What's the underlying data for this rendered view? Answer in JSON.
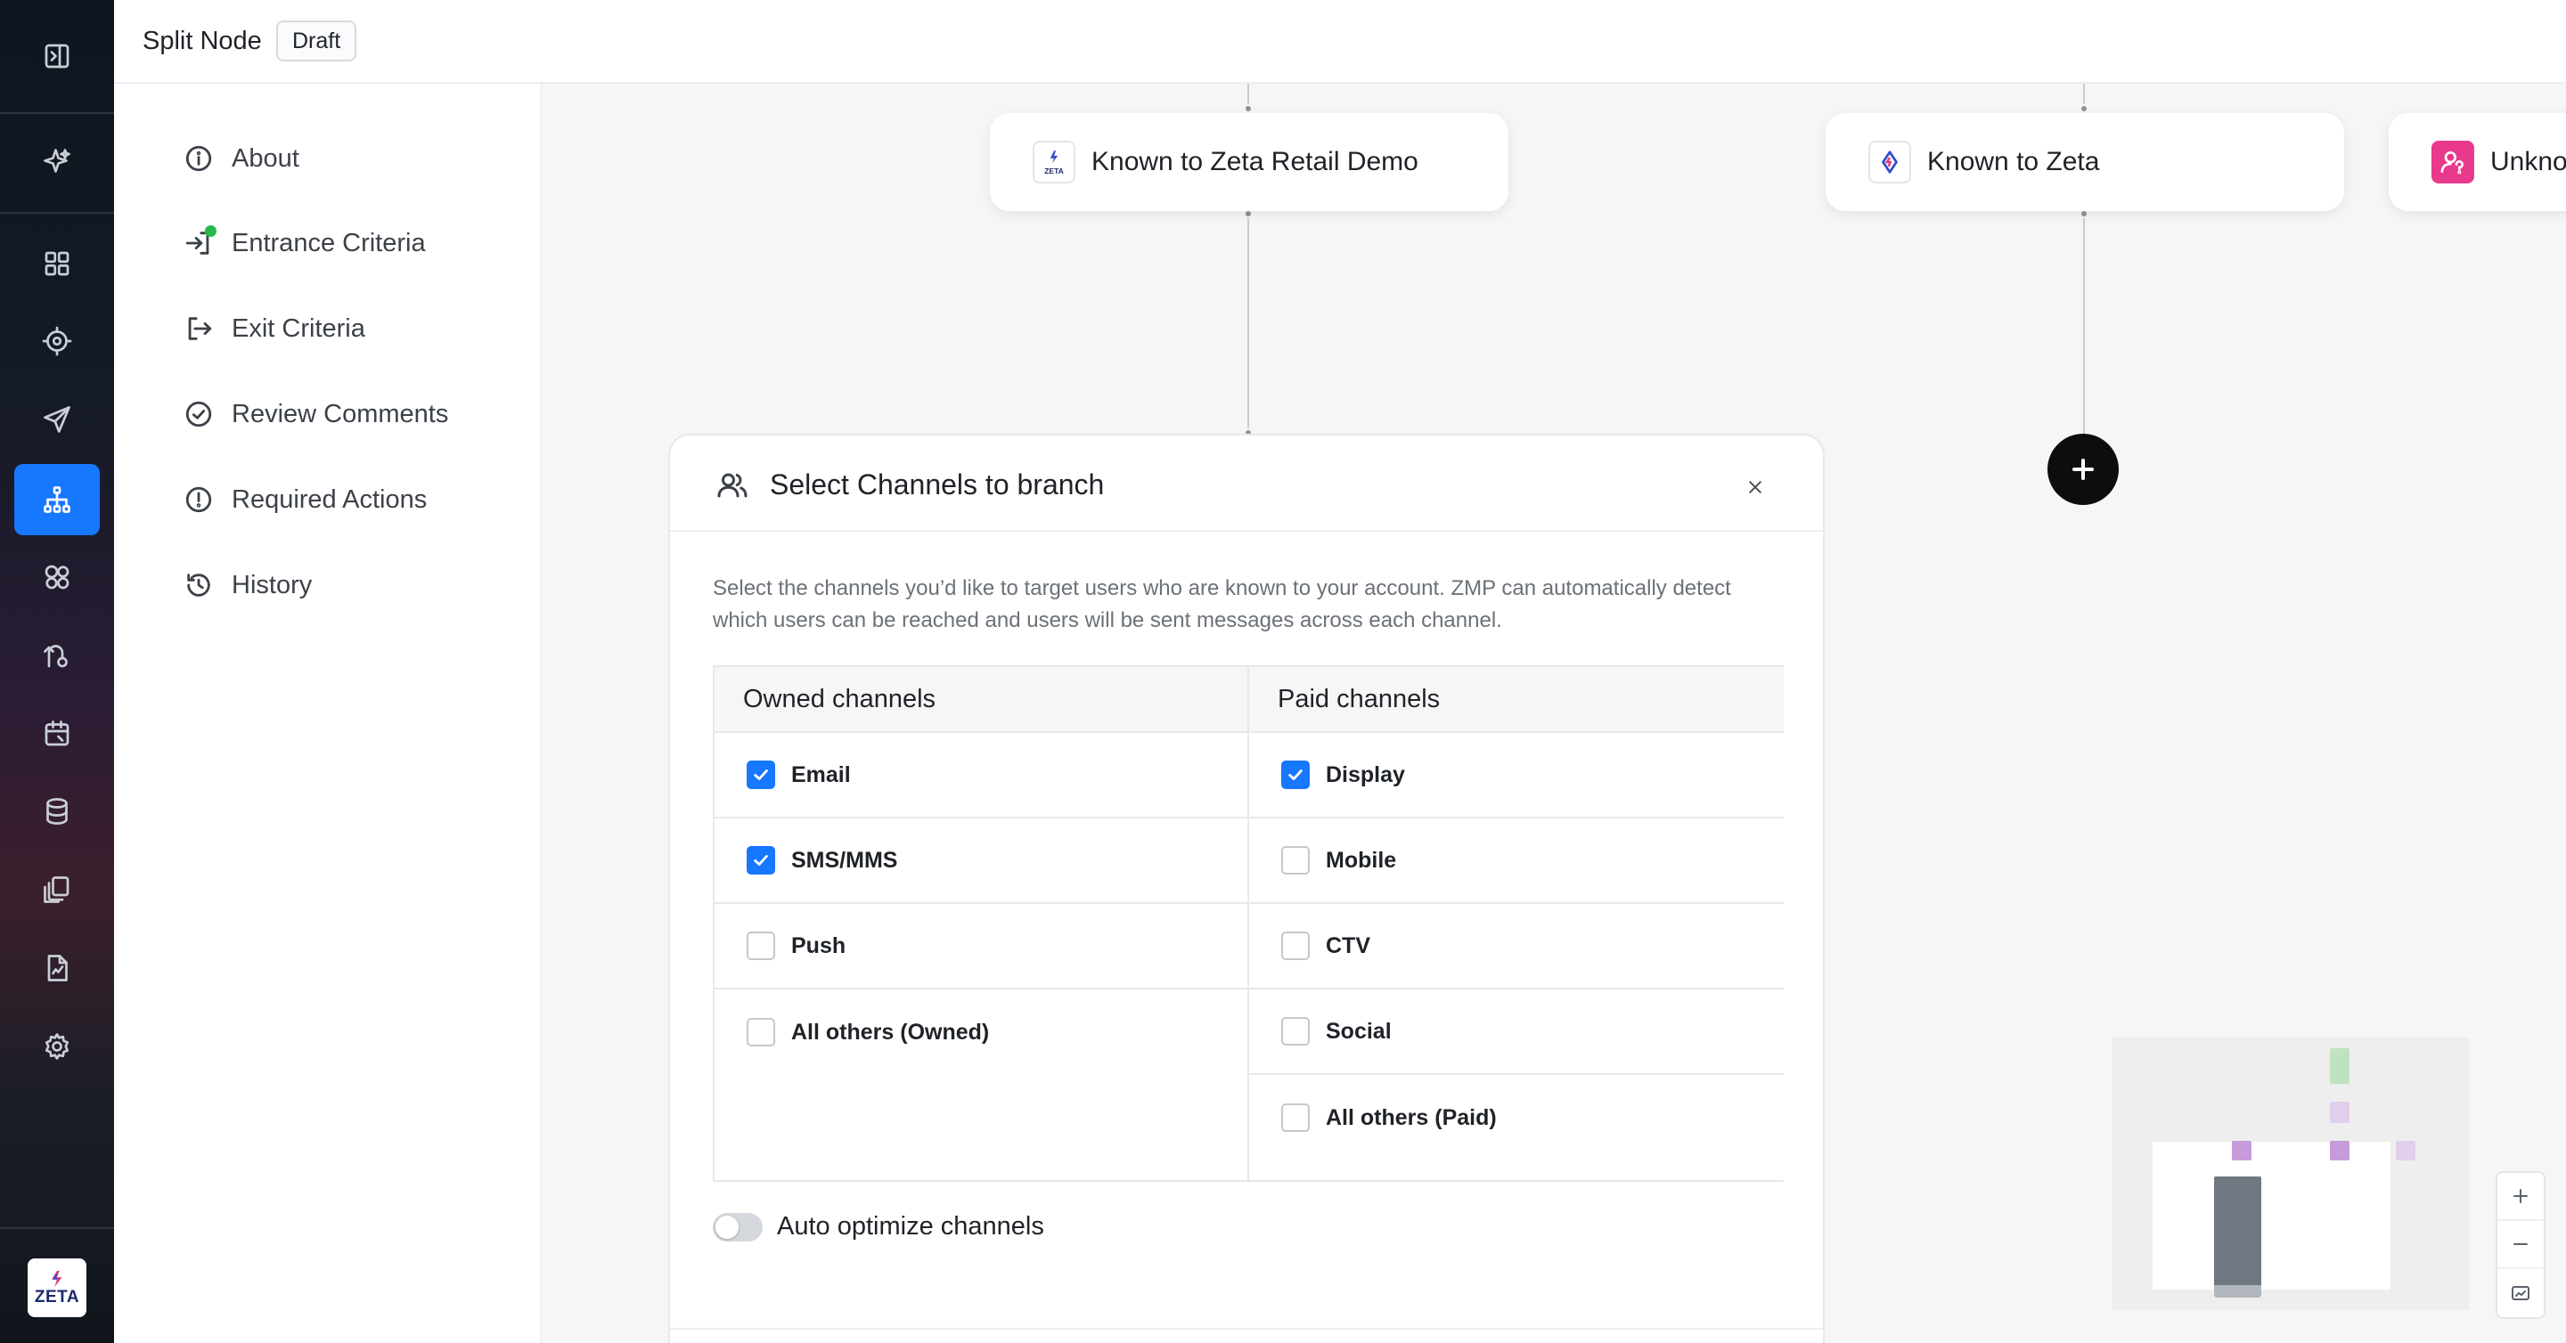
{
  "header": {
    "title": "Split Node",
    "badge": "Draft"
  },
  "rail": {
    "items": [
      {
        "icon": "panel-toggle-icon"
      },
      {
        "icon": "sparkle-icon"
      },
      {
        "icon": "dashboard-icon"
      },
      {
        "icon": "target-icon"
      },
      {
        "icon": "send-icon"
      },
      {
        "icon": "hierarchy-icon",
        "active": true
      },
      {
        "icon": "segments-icon"
      },
      {
        "icon": "journey-icon"
      },
      {
        "icon": "calendar-icon"
      },
      {
        "icon": "database-icon"
      },
      {
        "icon": "library-icon"
      },
      {
        "icon": "report-icon"
      },
      {
        "icon": "gear-icon"
      }
    ],
    "logo_text": "ZETA"
  },
  "side_menu": {
    "items": [
      {
        "label": "About",
        "icon": "info-icon"
      },
      {
        "label": "Entrance Criteria",
        "icon": "enter-icon",
        "status": "complete"
      },
      {
        "label": "Exit Criteria",
        "icon": "exit-icon"
      },
      {
        "label": "Review Comments",
        "icon": "check-circle-icon"
      },
      {
        "label": "Required Actions",
        "icon": "alert-circle-icon"
      },
      {
        "label": "History",
        "icon": "history-icon"
      }
    ]
  },
  "canvas": {
    "nodes": [
      {
        "label": "Known to Zeta Retail Demo",
        "icon": "zeta-retail-icon"
      },
      {
        "label": "Known to Zeta",
        "icon": "zeta-icon"
      },
      {
        "label": "Unkno",
        "icon": "unknown-user-icon"
      }
    ],
    "add_button_icon": "plus-icon"
  },
  "dialog": {
    "title": "Select Channels to branch",
    "description": "Select the channels you’d like to target users who are known to your account. ZMP can automatically detect which users can be reached and users will be sent messages across each channel.",
    "owned": {
      "header": "Owned channels",
      "channels": [
        {
          "label": "Email",
          "checked": true
        },
        {
          "label": "SMS/MMS",
          "checked": true
        },
        {
          "label": "Push",
          "checked": false
        },
        {
          "label": "All others (Owned)",
          "checked": false
        }
      ]
    },
    "paid": {
      "header": "Paid channels",
      "channels": [
        {
          "label": "Display",
          "checked": true
        },
        {
          "label": "Mobile",
          "checked": false
        },
        {
          "label": "CTV",
          "checked": false
        },
        {
          "label": "Social",
          "checked": false
        },
        {
          "label": "All others (Paid)",
          "checked": false
        }
      ]
    },
    "auto_optimize": {
      "label": "Auto optimize channels",
      "enabled": false
    }
  },
  "colors": {
    "accent": "#1677ff",
    "rail_bg": "#111722",
    "status_green": "#29b84a",
    "canvas_bg": "#f6f6f7"
  }
}
